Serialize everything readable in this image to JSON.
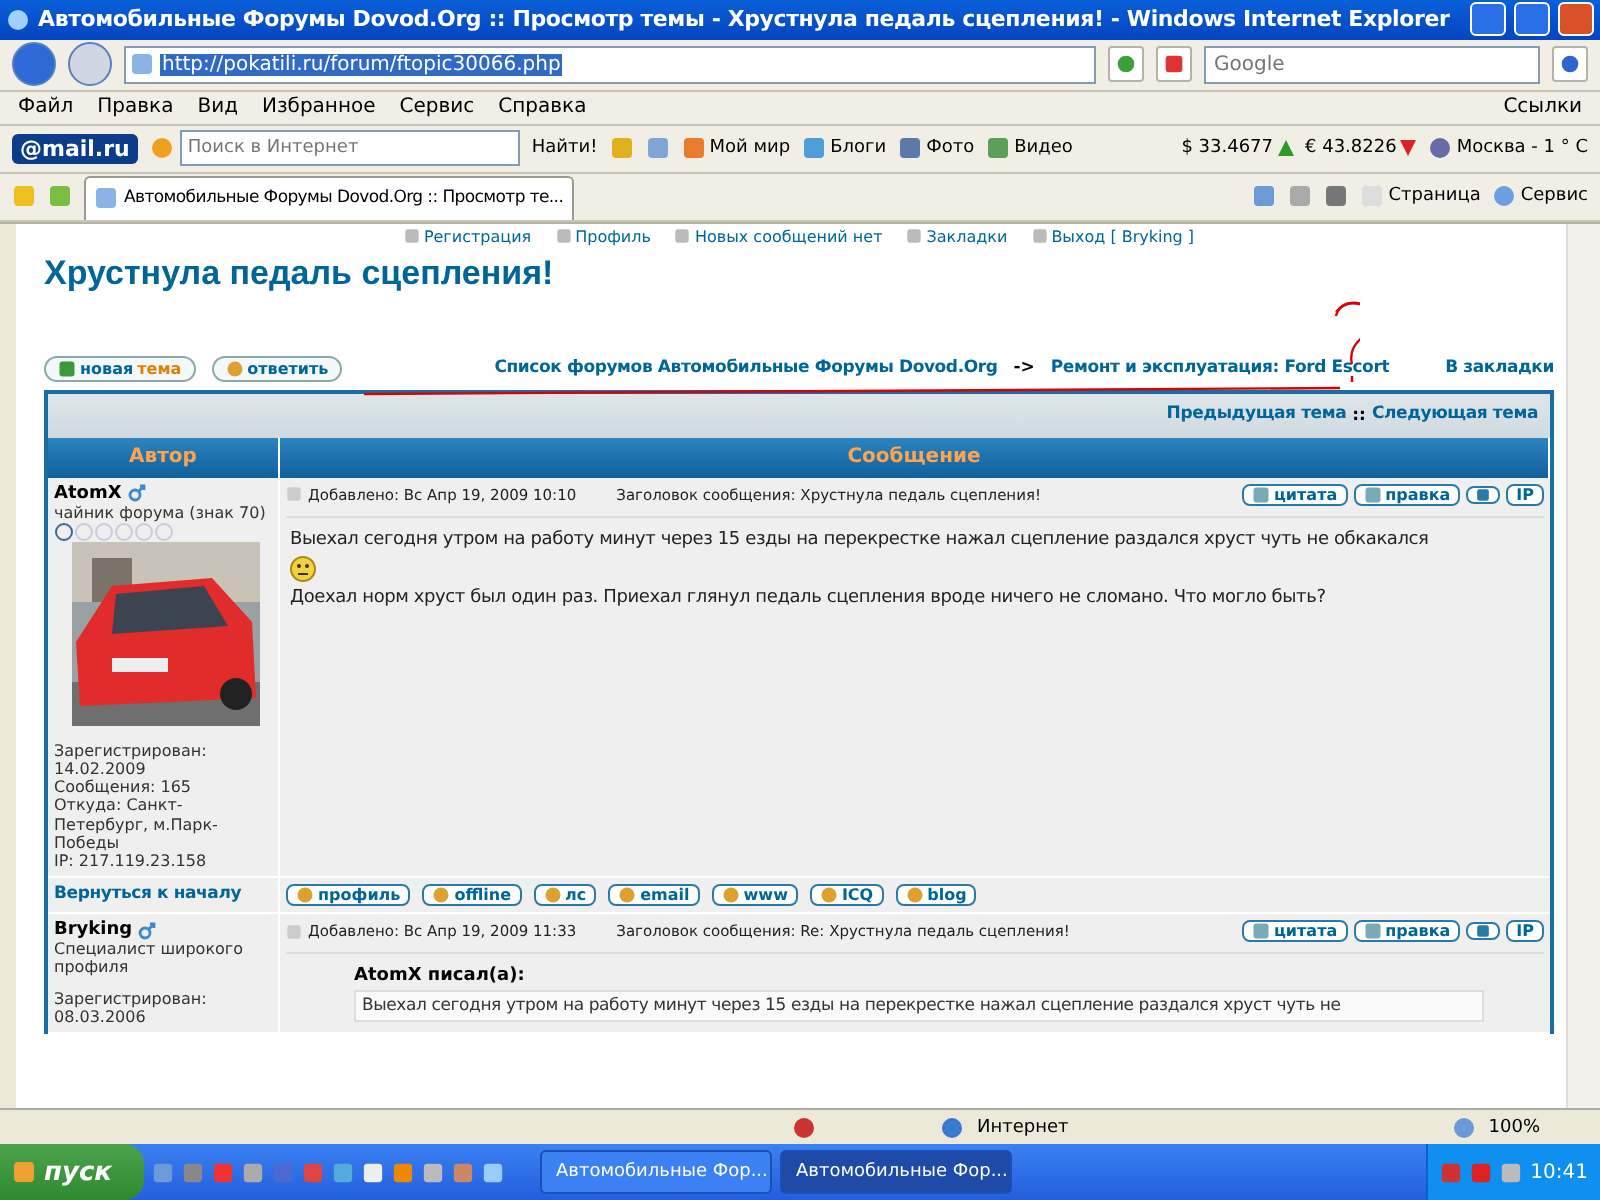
{
  "window": {
    "title": "Автомобильные Форумы Dovod.Org :: Просмотр темы - Хрустнула педаль сцепления! - Windows Internet Explorer"
  },
  "address": {
    "url": "http://pokatili.ru/forum/ftopic30066.php"
  },
  "search": {
    "placeholder": "Google"
  },
  "menu": [
    "Файл",
    "Правка",
    "Вид",
    "Избранное",
    "Сервис",
    "Справка"
  ],
  "links_label": "Ссылки",
  "mail_toolbar": {
    "logo": "@mail.ru",
    "search_placeholder": "Поиск в Интернет",
    "find": "Найти!",
    "items": [
      "Мой мир",
      "Блоги",
      "Фото",
      "Видео"
    ],
    "rates": [
      {
        "text": "$ 33.4677",
        "rising": true
      },
      {
        "text": "€ 43.8226",
        "rising": false
      }
    ],
    "weather": "Москва - 1 ° C"
  },
  "tab": {
    "title": "Автомобильные Форумы Dovod.Org :: Просмотр те..."
  },
  "command_bar": [
    "Страница",
    "Сервис"
  ],
  "forum": {
    "top_links": [
      "Регистрация",
      "Профиль",
      "Новых сообщений нет",
      "Закладки",
      "Выход [ Bryking ]"
    ],
    "topic_title": "Хрустнула педаль сцепления!",
    "new_topic": {
      "word1": "новая",
      "word2": "тема"
    },
    "reply": "ответить",
    "breadcrumb": [
      "Список форумов Автомобильные Форумы Dovod.Org",
      "Ремонт и эксплуатация: Ford Escort"
    ],
    "separator": "->",
    "bookmark": "В закладки",
    "nav": {
      "prev": "Предыдущая тема",
      "sep": "::",
      "next": "Следующая тема"
    },
    "columns": [
      "Автор",
      "Сообщение"
    ],
    "back_to_top": "Вернуться к началу",
    "profile_buttons": [
      "профиль",
      "offline",
      "лс",
      "email",
      "www",
      "ICQ",
      "blog"
    ],
    "posts": [
      {
        "author": "AtomX",
        "rank": "чайник форума (знак 70)",
        "avatar": {
          "kind": "picture"
        },
        "actions": [
          "цитата",
          "правка"
        ],
        "ip": "IP",
        "info": [
          "Зарегистрирован: 14.02.2009",
          "Сообщения: 165",
          "Откуда: Санкт-Петербург, м.Парк-Победы",
          "IP: 217.119.23.158"
        ],
        "posted": "Добавлено: Вс Апр 19, 2009 10:10",
        "subject": "Заголовок сообщения: Хрустнула педаль сцепления!",
        "body": [
          {
            "kind": "text",
            "text": "Выехал сегодня утром на работу минут через 15 езды на перекрестке нажал сцепление раздался хруст чуть не обкакался"
          },
          {
            "kind": "smiley"
          },
          {
            "kind": "text",
            "text": "Доехал норм хруст был один раз. Приехал глянул педаль сцепления вроде ничего не сломано. Что могло быть?"
          }
        ]
      },
      {
        "author": "Bryking",
        "rank": "Специалист широкого профиля",
        "actions": [
          "цитата",
          "правка"
        ],
        "ip": "IP",
        "info": [
          "Зарегистрирован: 08.03.2006"
        ],
        "posted": "Добавлено: Вс Апр 19, 2009 11:33",
        "subject": "Заголовок сообщения: Re: Хрустнула педаль сцепления!",
        "quote": {
          "author": "AtomX писал(а):",
          "text": "Выехал сегодня утром на работу минут через 15 езды на перекрестке нажал сцепление раздался хруст чуть не"
        }
      }
    ]
  },
  "status": {
    "zone": "Интернет",
    "zoom": "100%"
  },
  "taskbar": {
    "start": "пуск",
    "windows": [
      {
        "title": "Автомобильные Фор...",
        "selected": false
      },
      {
        "title": "Автомобильные Фор...",
        "selected": true
      }
    ],
    "clock": "10:41"
  }
}
